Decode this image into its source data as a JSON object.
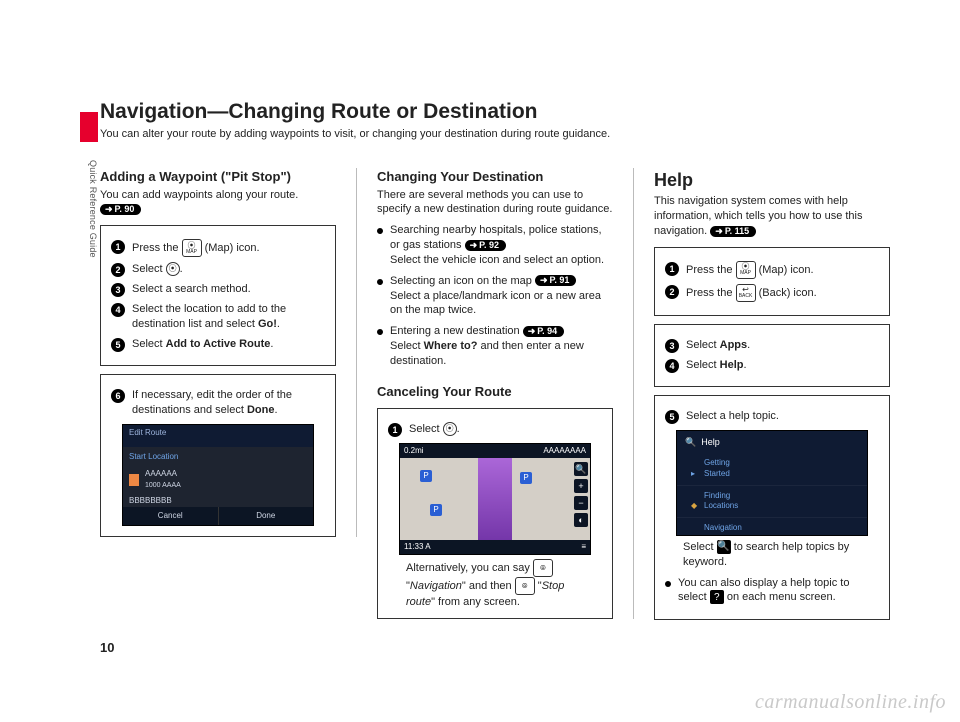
{
  "side_label": "Quick Reference Guide",
  "page_number": "10",
  "watermark": "carmanualsonline.info",
  "title": "Navigation—Changing Route or Destination",
  "subtitle": "You can alter your route by adding waypoints to visit, or changing your destination during route guidance.",
  "col1": {
    "heading": "Adding a Waypoint (\"Pit Stop\")",
    "intro": "You can add waypoints along your route.",
    "pref": "P. 90",
    "steps_a": {
      "s1a": "Press the ",
      "s1_icon_top": "⦿",
      "s1_icon_bot": "MAP",
      "s1b": " (Map) icon.",
      "s2a": "Select ",
      "s2_icon": "⦿",
      "s2b": ".",
      "s3": "Select a search method.",
      "s4a": "Select the location to add to the destination list and select ",
      "s4b": "Go!",
      "s4c": ".",
      "s5a": "Select ",
      "s5b": "Add to Active Route",
      "s5c": "."
    },
    "steps_b": {
      "s6a": "If necessary, edit the order of the destinations and select ",
      "s6b": "Done",
      "s6c": "."
    },
    "mock_edit": {
      "header": "Edit Route",
      "start": "Start Location",
      "dest1": "AAAAAA",
      "dest1_sub": "1000 AAAA",
      "dest2": "BBBBBBBB",
      "btn_cancel": "Cancel",
      "btn_done": "Done"
    }
  },
  "col2": {
    "heading": "Changing Your Destination",
    "intro": "There are several methods you can use to specify a new destination during route guidance.",
    "b1a": "Searching nearby hospitals, police stations, or gas stations ",
    "b1_pref": "P. 92",
    "b1b": "Select the vehicle icon and select an option.",
    "b2a": "Selecting an icon on the map ",
    "b2_pref": "P. 91",
    "b2b": "Select a place/landmark icon or a new area on the map twice.",
    "b3a": "Entering a new destination ",
    "b3_pref": "P. 94",
    "b3b_a": "Select ",
    "b3b_bold": "Where to?",
    "b3b_b": " and then enter a new destination.",
    "heading2": "Canceling Your Route",
    "cancel_step_a": "Select ",
    "cancel_icon": "⦿",
    "cancel_step_b": ".",
    "mock_nav": {
      "top_left": "0.2mi",
      "top_right": "AAAAAAAA",
      "bot_left": "11:33 A",
      "p_label": "P"
    },
    "alt_a": "Alternatively, you can say ",
    "alt_voice1": "⦾",
    "alt_b": " \"",
    "alt_i1": "Navigation",
    "alt_c": "\" and then ",
    "alt_d": " \"",
    "alt_i2": "Stop route",
    "alt_e": "\" from any screen."
  },
  "col3": {
    "heading": "Help",
    "intro": "This navigation system comes with help information, which tells you how to use this navigation. ",
    "pref": "P. 115",
    "steps_a": {
      "s1a": "Press the ",
      "s1_icon_top": "⦿",
      "s1_icon_bot": "MAP",
      "s1b": " (Map) icon.",
      "s2a": "Press the ",
      "s2_icon_top": "↩",
      "s2_icon_bot": "BACK",
      "s2b": " (Back) icon."
    },
    "steps_b": {
      "s3a": "Select ",
      "s3b": "Apps",
      "s3c": ".",
      "s4a": "Select ",
      "s4b": "Help",
      "s4c": "."
    },
    "steps_c": {
      "s5": "Select a help topic."
    },
    "mock_help": {
      "title": "Help",
      "i1": "Getting Started",
      "i2": "Finding Locations",
      "i3": "Navigation"
    },
    "note_a": "Select ",
    "note_icon": "🔍",
    "note_b": " to search help topics by keyword.",
    "bullet_a": "You can also display a help topic to select ",
    "bullet_icon": "?",
    "bullet_b": " on each menu screen."
  }
}
